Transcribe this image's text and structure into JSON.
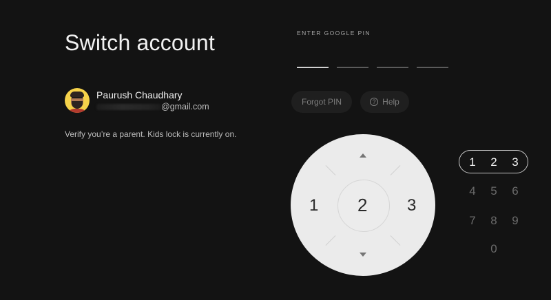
{
  "title": "Switch account",
  "account": {
    "name": "Paurush Chaudhary",
    "email_visible": "@gmail.com"
  },
  "verify_text": "Verify you’re a parent. Kids lock is currently on.",
  "pin": {
    "label": "ENTER GOOGLE PIN",
    "slots": 4,
    "filled": 1
  },
  "chips": {
    "forgot": "Forgot PIN",
    "help": "Help",
    "help_icon": "?"
  },
  "dial": {
    "left": "1",
    "center": "2",
    "right": "3"
  },
  "keypad": {
    "selected": [
      "1",
      "2",
      "3"
    ],
    "row2": [
      "4",
      "5",
      "6"
    ],
    "row3": [
      "7",
      "8",
      "9"
    ],
    "row4": [
      "0"
    ]
  },
  "colors": {
    "background": "#131313",
    "dial": "#ebebeb",
    "selection_ring": "#c9c9c9"
  }
}
